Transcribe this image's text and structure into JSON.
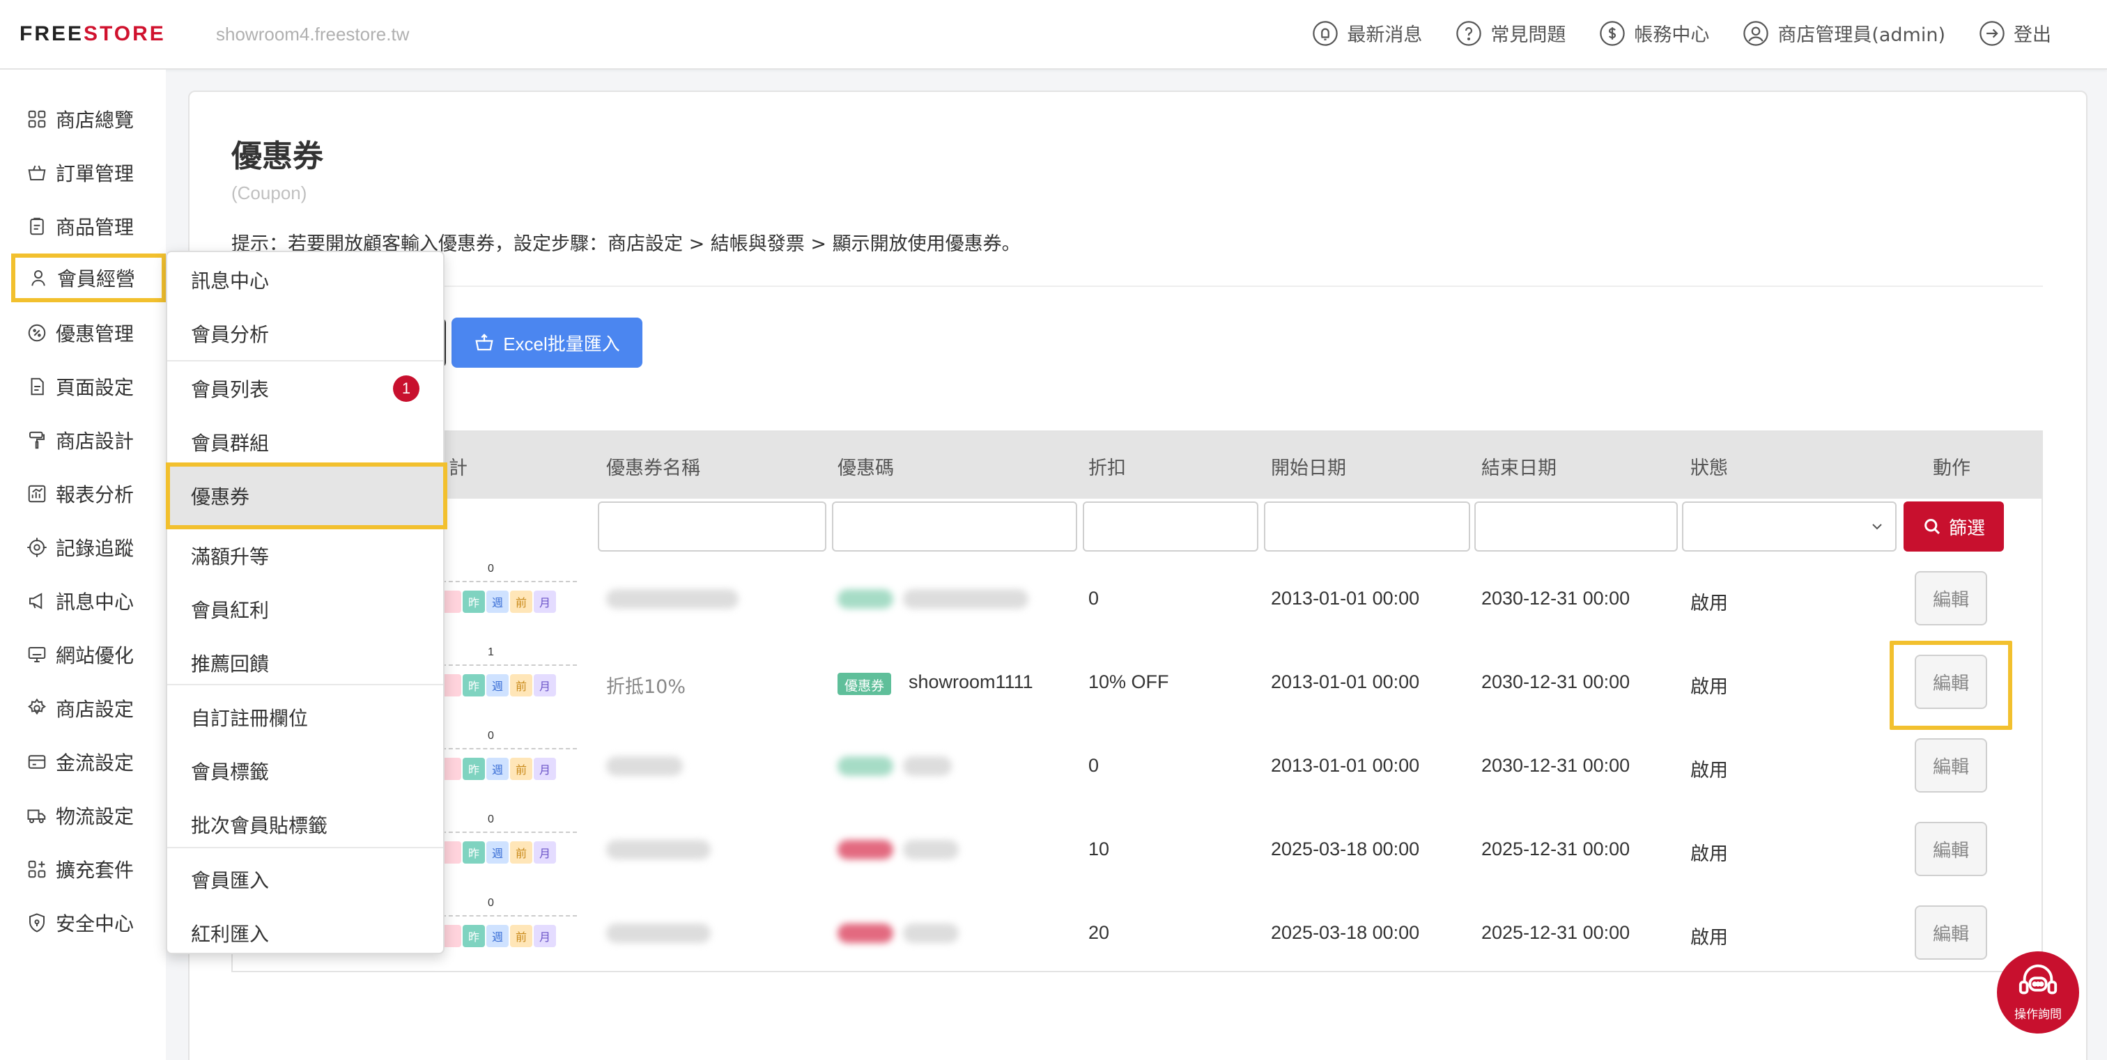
{
  "app": {
    "logo_prefix": "FREE",
    "logo_suffix": "STORE",
    "domain": "showroom4.freestore.tw"
  },
  "topnav": {
    "news": "最新消息",
    "faq": "常見問題",
    "billing": "帳務中心",
    "admin": "商店管理員(admin)",
    "logout": "登出"
  },
  "sidebar": {
    "items": [
      {
        "label": "商店總覽",
        "icon": "grid-icon"
      },
      {
        "label": "訂單管理",
        "icon": "basket-icon"
      },
      {
        "label": "商品管理",
        "icon": "clipboard-icon"
      },
      {
        "label": "會員經營",
        "icon": "user-icon"
      },
      {
        "label": "優惠管理",
        "icon": "discount-icon"
      },
      {
        "label": "頁面設定",
        "icon": "page-icon"
      },
      {
        "label": "商店設計",
        "icon": "paint-roller-icon"
      },
      {
        "label": "報表分析",
        "icon": "chart-icon"
      },
      {
        "label": "記錄追蹤",
        "icon": "target-icon"
      },
      {
        "label": "訊息中心",
        "icon": "megaphone-icon"
      },
      {
        "label": "網站優化",
        "icon": "monitor-icon"
      },
      {
        "label": "商店設定",
        "icon": "gear-icon"
      },
      {
        "label": "金流設定",
        "icon": "card-icon"
      },
      {
        "label": "物流設定",
        "icon": "truck-icon"
      },
      {
        "label": "擴充套件",
        "icon": "plugin-icon"
      },
      {
        "label": "安全中心",
        "icon": "shield-icon"
      }
    ]
  },
  "page": {
    "title": "優惠券",
    "subtitle": "(Coupon)",
    "hint": "提示：若要開放顧客輸入優惠券，設定步驟：商店設定 > 結帳與發票 > 顯示開放使用優惠券。",
    "excel_button": "Excel批量匯入"
  },
  "table": {
    "headers": {
      "stats": "計",
      "name": "優惠券名稱",
      "code": "優惠碼",
      "discount": "折扣",
      "start": "開始日期",
      "end": "結束日期",
      "status": "狀態",
      "action": "動作"
    },
    "filter_button": "篩選",
    "edit_label": "編輯",
    "chips": [
      "昨",
      "週",
      "前",
      "月"
    ],
    "rows": [
      {
        "count": "0",
        "name": "",
        "code": "",
        "discount": "0",
        "start": "2013-01-01 00:00",
        "end": "2030-12-31 00:00",
        "status": "啟用"
      },
      {
        "count": "1",
        "name": "折抵10%",
        "tag": "優惠券",
        "code": "showroom1111",
        "discount": "10% OFF",
        "start": "2013-01-01 00:00",
        "end": "2030-12-31 00:00",
        "status": "啟用"
      },
      {
        "count": "0",
        "name": "",
        "code": "",
        "discount": "0",
        "start": "2013-01-01 00:00",
        "end": "2030-12-31 00:00",
        "status": "啟用"
      },
      {
        "count": "0",
        "name": "",
        "code": "",
        "discount": "10",
        "start": "2025-03-18 00:00",
        "end": "2025-12-31 00:00",
        "status": "啟用"
      },
      {
        "count": "0",
        "name": "",
        "code": "",
        "discount": "20",
        "start": "2025-03-18 00:00",
        "end": "2025-12-31 00:00",
        "status": "啟用"
      }
    ]
  },
  "dropdown": {
    "items": [
      {
        "label": "訊息中心"
      },
      {
        "label": "會員分析"
      },
      {
        "label": "會員列表",
        "badge": "1"
      },
      {
        "label": "會員群組"
      },
      {
        "label": "優惠券"
      },
      {
        "label": "滿額升等"
      },
      {
        "label": "會員紅利"
      },
      {
        "label": "推薦回饋"
      },
      {
        "label": "自訂註冊欄位"
      },
      {
        "label": "會員標籤"
      },
      {
        "label": "批次會員貼標籤"
      },
      {
        "label": "會員匯入"
      },
      {
        "label": "紅利匯入"
      }
    ]
  },
  "help": {
    "label": "操作詢問"
  },
  "colors": {
    "brand_red": "#c8102e",
    "highlight_yellow": "#f2c02e",
    "excel_blue": "#4b86f0",
    "coupon_tag_green": "#5fbf9a"
  }
}
